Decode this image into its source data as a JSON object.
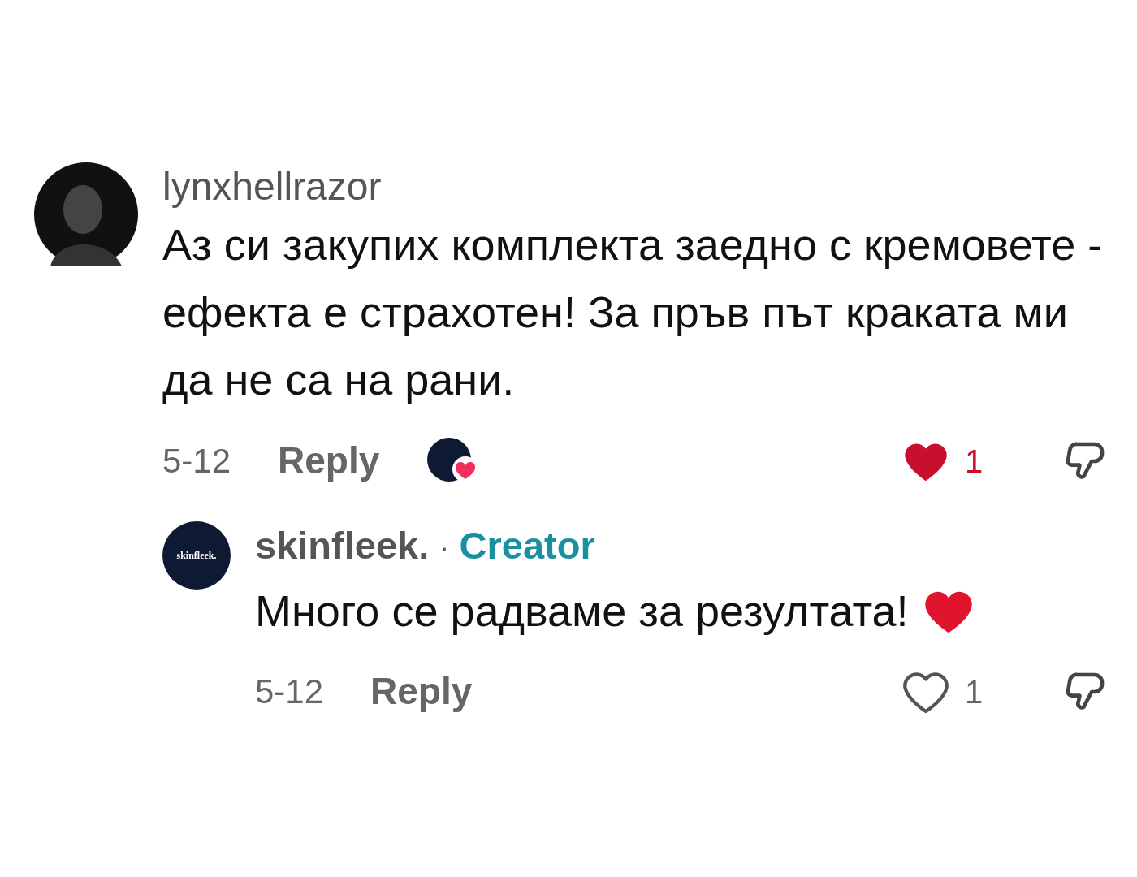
{
  "comments": [
    {
      "username": "lynxhellrazor",
      "text": "Аз си закупих комплекта заедно с кремовете - ефекта е страхотен! За пръв път краката ми да не са на рани.",
      "date": "5-12",
      "reply_label": "Reply",
      "liked_by_creator": true,
      "liked": true,
      "like_count": "1",
      "replies": [
        {
          "username": "skinfleek.",
          "avatar_text": "skinfleek.",
          "separator": "·",
          "role": "Creator",
          "text": "Много се радваме за резултата!",
          "heart_emoji": true,
          "date": "5-12",
          "reply_label": "Reply",
          "liked_by_creator": false,
          "liked": false,
          "like_count": "1"
        }
      ]
    }
  ]
}
